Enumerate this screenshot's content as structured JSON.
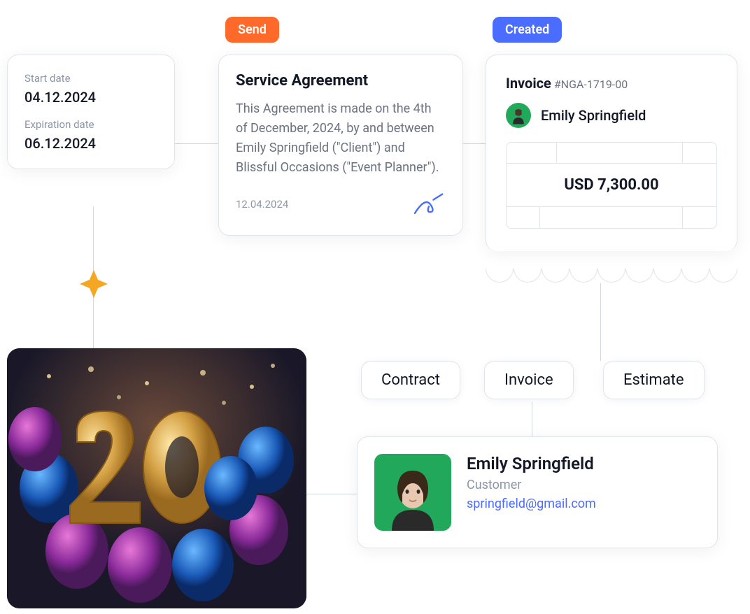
{
  "dates": {
    "start_label": "Start date",
    "start_value": "04.12.2024",
    "exp_label": "Expiration date",
    "exp_value": "06.12.2024"
  },
  "badges": {
    "send": "Send",
    "created": "Created"
  },
  "agreement": {
    "title": "Service Agreement",
    "body": "This Agreement is made on the 4th of December, 2024, by and between Emily Springfield (\"Client\") and Blissful Occasions (\"Event Planner\").",
    "date": "12.04.2024"
  },
  "invoice": {
    "title": "Invoice",
    "number": "#NGA-1719-00",
    "name": "Emily Springfield",
    "amount": "USD 7,300.00"
  },
  "pills": {
    "contract": "Contract",
    "invoice": "Invoice",
    "estimate": "Estimate"
  },
  "customer": {
    "name": "Emily Springfield",
    "role": "Customer",
    "email": "springfield@gmail.com"
  }
}
